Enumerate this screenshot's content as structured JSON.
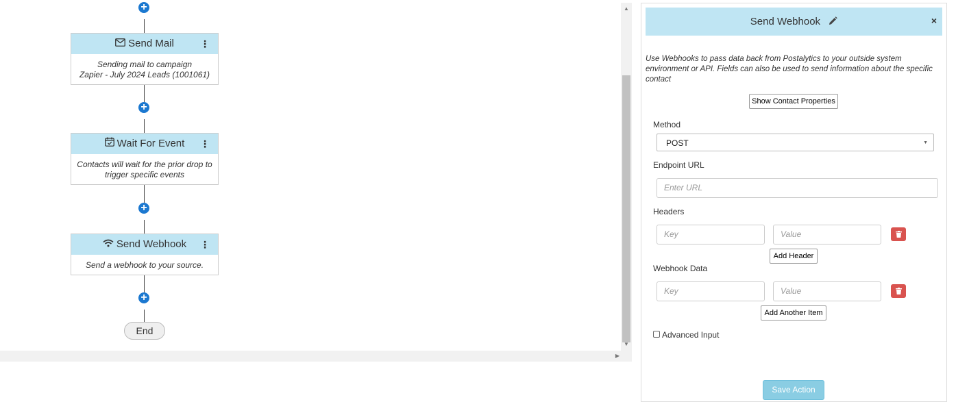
{
  "flow": {
    "nodes": [
      {
        "title": "Send Mail",
        "icon": "envelope-icon",
        "body_line1": "Sending mail to campaign",
        "body_line2": "Zapier - July 2024 Leads (1001061)"
      },
      {
        "title": "Wait For Event",
        "icon": "calendar-check-icon",
        "body_line1": "Contacts will wait for the prior drop to",
        "body_line2": "trigger specific events"
      },
      {
        "title": "Send Webhook",
        "icon": "wifi-icon",
        "body_line1": "Send a webhook to your source.",
        "body_line2": ""
      }
    ],
    "end_label": "End"
  },
  "panel": {
    "title": "Send Webhook",
    "description": "Use Webhooks to pass data back from Postalytics to your outside system environment or API. Fields can also be used to send information about the specific contact",
    "show_props_label": "Show Contact Properties",
    "method_label": "Method",
    "method_value": "POST",
    "endpoint_label": "Endpoint URL",
    "endpoint_placeholder": "Enter URL",
    "headers_label": "Headers",
    "key_placeholder": "Key",
    "value_placeholder": "Value",
    "add_header_label": "Add Header",
    "webhook_data_label": "Webhook Data",
    "add_item_label": "Add Another Item",
    "advanced_label": "Advanced Input",
    "save_label": "Save Action"
  },
  "colors": {
    "accent": "#bfe5f3",
    "plus": "#1b78d0",
    "danger": "#d9534f",
    "save": "#8acde3"
  }
}
